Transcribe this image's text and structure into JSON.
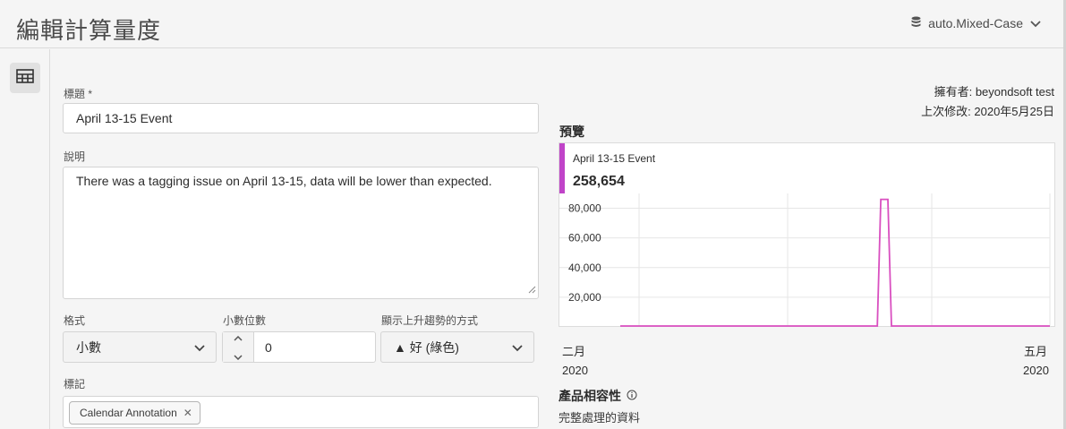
{
  "header": {
    "title": "編輯計算量度",
    "suite": "auto.Mixed-Case"
  },
  "form": {
    "title_label": "標題",
    "required_mark": "*",
    "title_value": "April 13-15 Event",
    "desc_label": "說明",
    "desc_value": "There was a tagging issue on April 13-15, data will be lower than expected.",
    "format_label": "格式",
    "format_value": "小數",
    "decimals_label": "小數位數",
    "decimals_value": "0",
    "trend_label": "顯示上升趨勢的方式",
    "trend_value": "▲ 好 (綠色)",
    "tags_label": "標記",
    "tags": [
      "Calendar Annotation"
    ]
  },
  "meta": {
    "owner_label": "擁有者:",
    "owner_value": "beyondsoft test",
    "modified_label": "上次修改:",
    "modified_value": "2020年5月25日"
  },
  "preview": {
    "title": "預覽",
    "metric_name": "April 13-15 Event",
    "metric_value": "258,654",
    "accent_color": "#c044c8",
    "line_color": "#d94fc0"
  },
  "chart_data": {
    "type": "line",
    "series": [
      {
        "values": [
          0,
          0,
          0,
          0,
          0,
          0,
          0,
          0,
          0,
          0,
          0,
          0,
          0,
          0,
          0,
          0,
          0,
          0,
          0,
          0,
          0,
          0,
          0,
          0,
          0,
          0,
          0,
          0,
          0,
          0,
          0,
          0,
          0,
          0,
          0,
          0,
          0,
          0,
          0,
          0,
          0,
          0,
          0,
          0,
          0,
          0,
          0,
          0,
          0,
          0,
          0,
          0,
          0,
          0,
          0,
          0,
          0,
          0,
          0,
          0,
          0,
          0,
          0,
          0,
          0,
          0,
          0,
          0,
          0,
          0,
          0,
          0,
          0,
          0,
          86000,
          86000,
          86000,
          0,
          0,
          0,
          0,
          0,
          0,
          0,
          0,
          0,
          0,
          0,
          0,
          0,
          0,
          0,
          0,
          0,
          0,
          0,
          0,
          0,
          0,
          0,
          0,
          0,
          0,
          0,
          0,
          0,
          0,
          0,
          0,
          0,
          0,
          0,
          0,
          0,
          0,
          0,
          0,
          0,
          0,
          0,
          0,
          0,
          0
        ]
      }
    ],
    "ylim": [
      0,
      90000
    ],
    "y_ticks": [
      "80,000",
      "60,000",
      "40,000",
      "20,000"
    ],
    "y_tick_values": [
      80000,
      60000,
      40000,
      20000
    ],
    "x_label_left": {
      "month": "二月",
      "year": "2020"
    },
    "x_label_right": {
      "month": "五月",
      "year": "2020"
    },
    "grid": true
  },
  "compat": {
    "title": "產品相容性",
    "subtitle": "完整處理的資料"
  }
}
